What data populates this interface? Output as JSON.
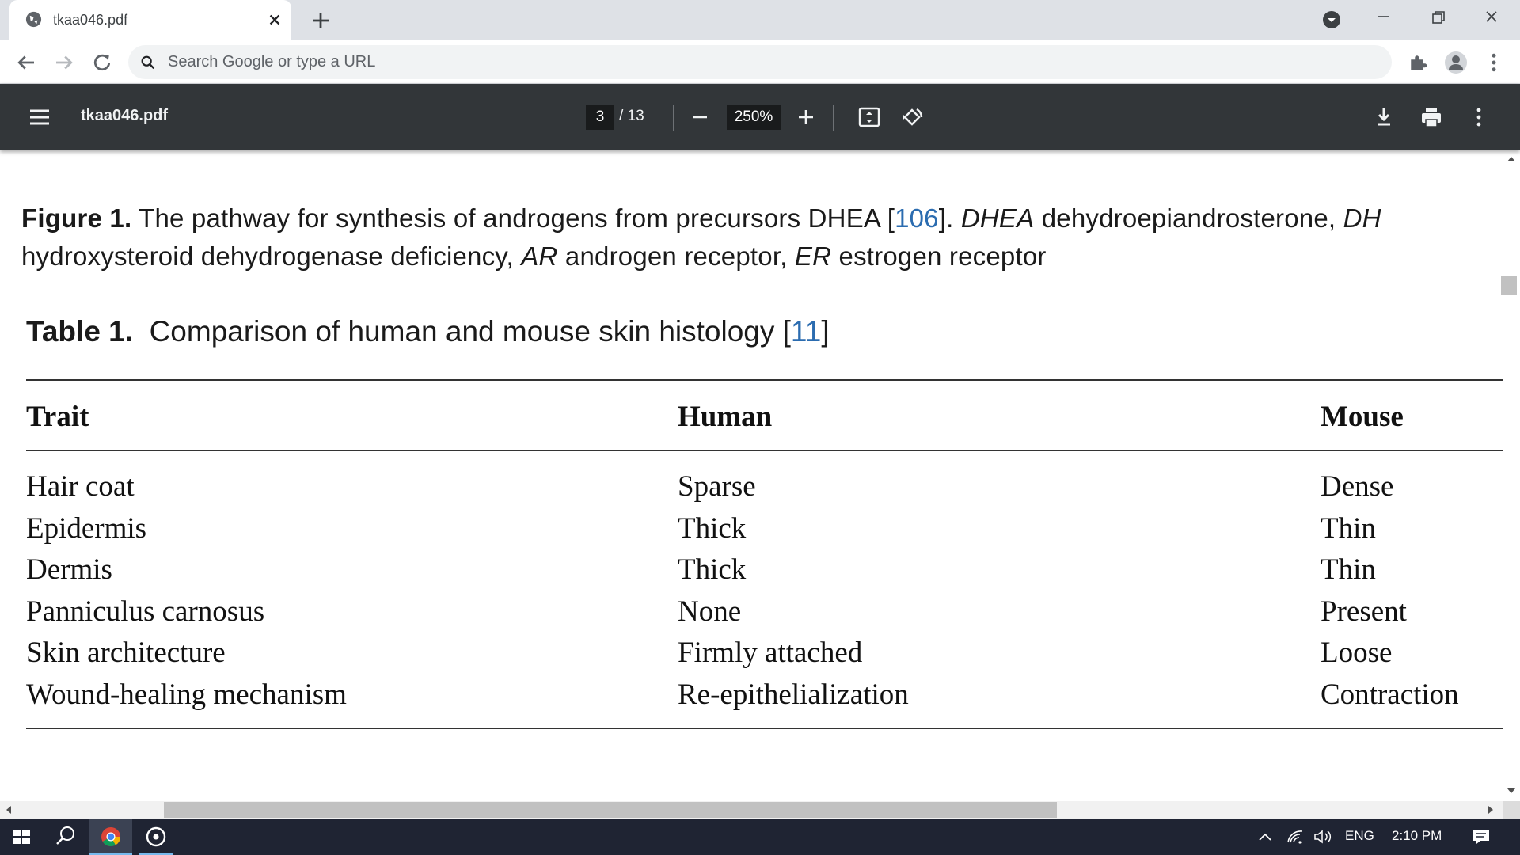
{
  "browser": {
    "tab_title": "tkaa046.pdf",
    "search_placeholder": "Search Google or type a URL"
  },
  "pdf_toolbar": {
    "doc_name": "tkaa046.pdf",
    "current_page": "3",
    "total_pages": "/ 13",
    "zoom": "250%"
  },
  "document": {
    "figure_caption": {
      "label": "Figure 1.",
      "line1_text": " The pathway for synthesis of androgens from precursors DHEA [",
      "line1_ref": "106",
      "line1_after_ref": "]. ",
      "line1_abbr1": "DHEA",
      "line1_abbr1_def": " dehydroepiandrosterone, ",
      "line1_abbr2": "DH",
      "line2_text": "hydroxysteroid dehydrogenase deficiency, ",
      "line2_abbr1": "AR",
      "line2_abbr1_def": " androgen receptor, ",
      "line2_abbr2": "ER",
      "line2_abbr2_def": " estrogen receptor"
    },
    "table": {
      "label": "Table 1.",
      "title": "  Comparison of human and mouse skin histology [",
      "ref": "11",
      "title_end": "]",
      "headers": [
        "Trait",
        "Human",
        "Mouse"
      ],
      "rows": [
        [
          "Hair coat",
          "Sparse",
          "Dense"
        ],
        [
          "Epidermis",
          "Thick",
          "Thin"
        ],
        [
          "Dermis",
          "Thick",
          "Thin"
        ],
        [
          "Panniculus carnosus",
          "None",
          "Present"
        ],
        [
          "Skin architecture",
          "Firmly attached",
          "Loose"
        ],
        [
          "Wound-healing mechanism",
          "Re-epithelialization",
          "Contraction"
        ]
      ]
    }
  },
  "taskbar": {
    "language": "ENG",
    "time": "2:10 PM"
  },
  "colors": {
    "pdf_toolbar": "#323639",
    "link": "#2b6cb0",
    "taskbar": "#1f2433"
  }
}
